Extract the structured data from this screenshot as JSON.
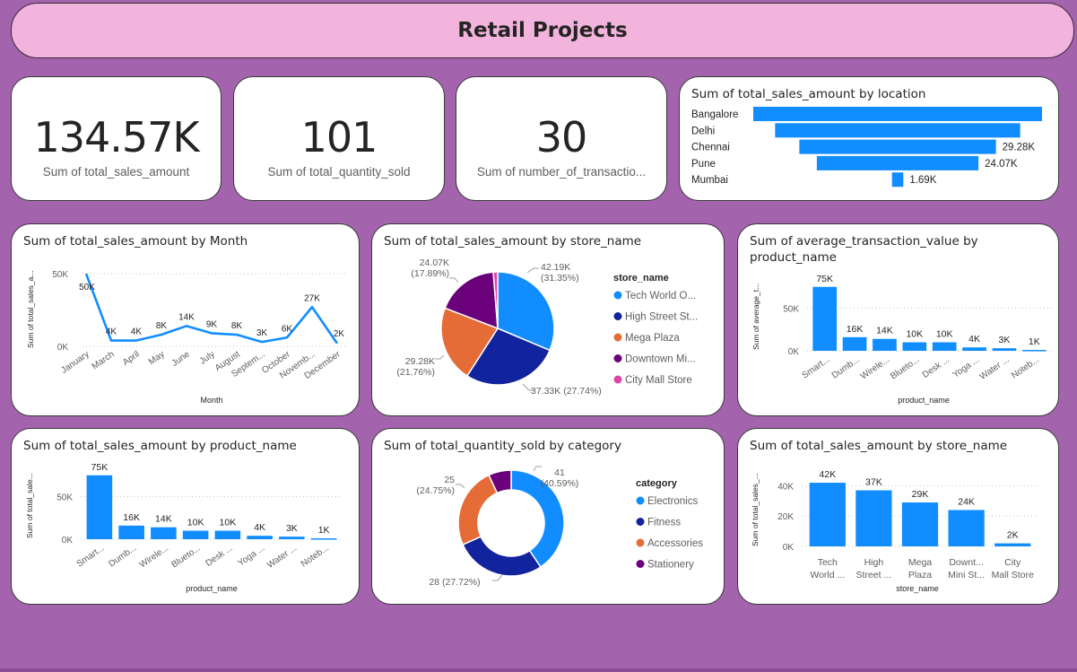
{
  "banner": {
    "title": "Retail Projects"
  },
  "colors": {
    "bar": "#118dff",
    "page_bg": "#a363ad",
    "banner_bg": "#f2b3dc"
  },
  "kpis": [
    {
      "value": "134.57K",
      "label": "Sum of total_sales_amount"
    },
    {
      "value": "101",
      "label": "Sum of total_quantity_sold"
    },
    {
      "value": "30",
      "label": "Sum of number_of_transactio..."
    }
  ],
  "chart_data": [
    {
      "id": "funnel-location",
      "type": "bar",
      "title": "Sum of total_sales_amount by location",
      "categories": [
        "Bangalore",
        "Delhi",
        "Chennai",
        "Pune",
        "Mumbai"
      ],
      "values": [
        43.0,
        36.5,
        29.28,
        24.07,
        1.69
      ],
      "labels": [
        "",
        "",
        "29.28K",
        "24.07K",
        "1.69K"
      ],
      "orientation": "funnel"
    },
    {
      "id": "line-month",
      "type": "line",
      "title": "Sum of total_sales_amount by Month",
      "xlabel": "Month",
      "ylabel": "Sum of total_sales_a...",
      "ytick_labels": [
        "0K",
        "50K"
      ],
      "ylim": [
        0,
        50
      ],
      "categories": [
        "January",
        "March",
        "April",
        "May",
        "June",
        "July",
        "August",
        "Septem...",
        "October",
        "Novemb...",
        "December"
      ],
      "values": [
        50,
        4,
        4,
        8,
        14,
        9,
        8,
        3,
        6,
        27,
        2
      ],
      "labels": [
        "50K",
        "4K",
        "4K",
        "8K",
        "14K",
        "9K",
        "8K",
        "3K",
        "6K",
        "27K",
        "2K"
      ]
    },
    {
      "id": "pie-store",
      "type": "pie",
      "title": "Sum of total_sales_amount by store_name",
      "legend_title": "store_name",
      "categories": [
        "Tech World O...",
        "High Street St...",
        "Mega Plaza",
        "Downtown Mi...",
        "City Mall Store"
      ],
      "values": [
        42.19,
        37.33,
        29.28,
        24.07,
        1.69
      ],
      "labels": [
        "42.19K (31.35%)",
        "37.33K (27.74%)",
        "29.28K (21.76%)",
        "24.07K (17.89%)",
        ""
      ],
      "colors": [
        "#118dff",
        "#12239e",
        "#e66c37",
        "#6b007b",
        "#e044a7"
      ]
    },
    {
      "id": "bar-avg-product",
      "type": "bar",
      "title": "Sum of average_transaction_value by product_name",
      "xlabel": "product_name",
      "ylabel": "Sum of average_t...",
      "ytick_labels": [
        "0K",
        "50K"
      ],
      "ylim": [
        0,
        80
      ],
      "categories": [
        "Smart...",
        "Dumb...",
        "Wirele...",
        "Blueto...",
        "Desk ...",
        "Yoga ...",
        "Water ...",
        "Noteb..."
      ],
      "values": [
        75,
        16,
        14,
        10,
        10,
        4,
        3,
        1
      ],
      "labels": [
        "75K",
        "16K",
        "14K",
        "10K",
        "10K",
        "4K",
        "3K",
        "1K"
      ]
    },
    {
      "id": "bar-sales-product",
      "type": "bar",
      "title": "Sum of total_sales_amount by product_name",
      "xlabel": "product_name",
      "ylabel": "Sum of total_sale...",
      "ytick_labels": [
        "0K",
        "50K"
      ],
      "ylim": [
        0,
        80
      ],
      "categories": [
        "Smart...",
        "Dumb...",
        "Wirele...",
        "Blueto...",
        "Desk ...",
        "Yoga ...",
        "Water ...",
        "Noteb..."
      ],
      "values": [
        75,
        16,
        14,
        10,
        10,
        4,
        3,
        1
      ],
      "labels": [
        "75K",
        "16K",
        "14K",
        "10K",
        "10K",
        "4K",
        "3K",
        "1K"
      ]
    },
    {
      "id": "donut-category",
      "type": "pie",
      "title": "Sum of total_quantity_sold by category",
      "legend_title": "category",
      "categories": [
        "Electronics",
        "Fitness",
        "Accessories",
        "Stationery"
      ],
      "values": [
        41,
        28,
        25,
        7
      ],
      "labels": [
        "41 (40.59%)",
        "28 (27.72%)",
        "25 (24.75%)",
        ""
      ],
      "colors": [
        "#118dff",
        "#12239e",
        "#e66c37",
        "#6b007b"
      ],
      "donut": true
    },
    {
      "id": "bar-store",
      "type": "bar",
      "title": "Sum of total_sales_amount by store_name",
      "xlabel": "store_name",
      "ylabel": "Sum of total_sales_...",
      "ytick_labels": [
        "0K",
        "20K",
        "40K"
      ],
      "ylim": [
        0,
        45
      ],
      "categories": [
        "Tech World ...",
        "High Street ...",
        "Mega Plaza",
        "Downt... Mini St...",
        "City Mall Store"
      ],
      "values": [
        42,
        37,
        29,
        24,
        2
      ],
      "labels": [
        "42K",
        "37K",
        "29K",
        "24K",
        "2K"
      ]
    }
  ]
}
